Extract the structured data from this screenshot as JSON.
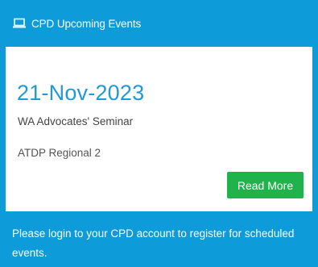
{
  "header": {
    "icon": "laptop-icon",
    "title": "CPD Upcoming Events"
  },
  "event": {
    "date": "21-Nov-2023",
    "name": "WA Advocates' Seminar",
    "subtitle": "ATDP Regional 2",
    "read_more_label": "Read More"
  },
  "footer": {
    "message": "Please login to your CPD account to register for scheduled events."
  },
  "colors": {
    "panel_blue": "#0e9bd9",
    "date_blue": "#1f9ad6",
    "button_green": "#21b34b"
  }
}
